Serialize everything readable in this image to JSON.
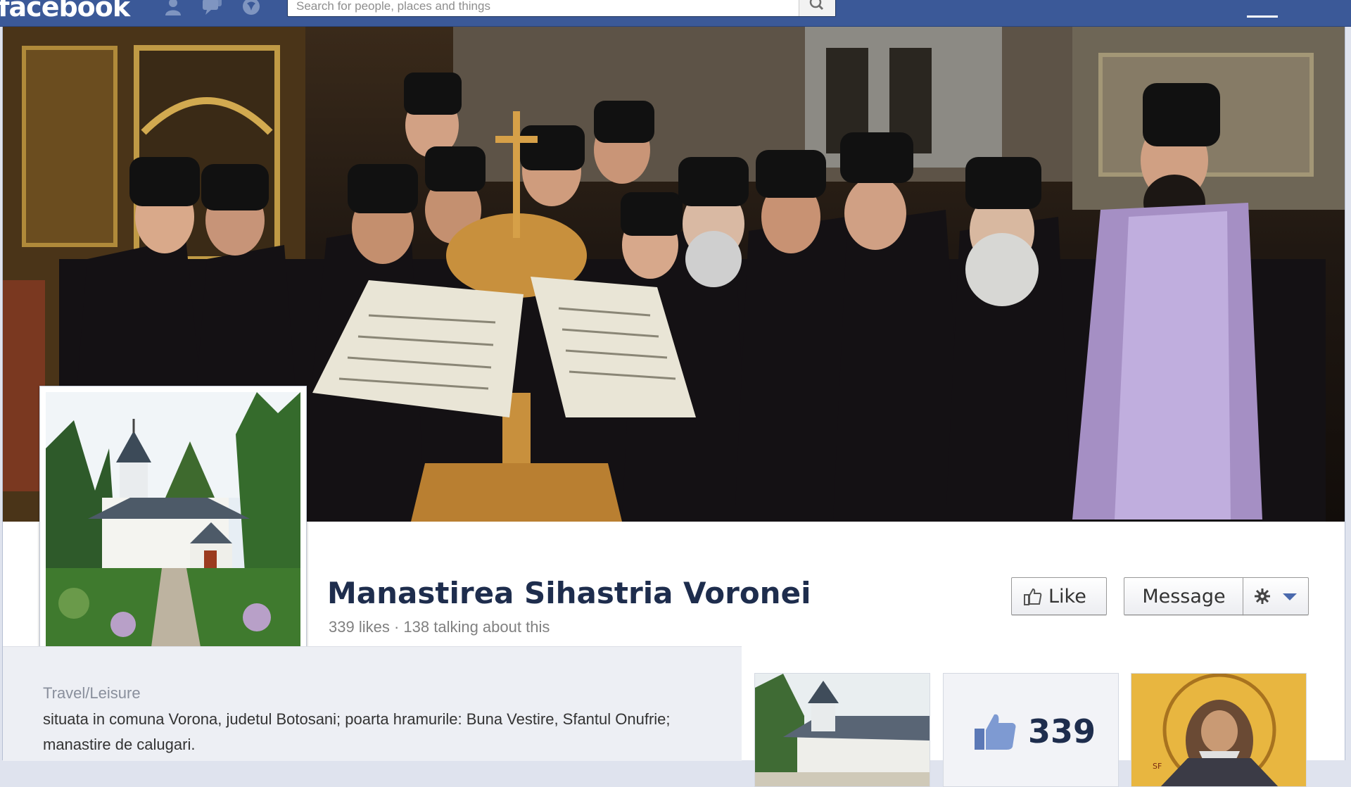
{
  "topbar": {
    "logo": "facebook",
    "search_placeholder": "Search for people, places and things",
    "colors": {
      "bar": "#3b5998",
      "border": "#29447e"
    }
  },
  "page": {
    "name": "Manastirea Sihastria Voronei",
    "likes": "339 likes",
    "separator": " · ",
    "talking": "138 talking about this"
  },
  "actions": {
    "like_label": "Like",
    "message_label": "Message"
  },
  "about": {
    "category": "Travel/Leisure",
    "description": "situata in comuna Vorona, judetul Botosani; poarta hramurile: Buna Vestire, Sfantul Onufrie; manastire de calugari."
  },
  "tiles": {
    "likes_count": "339"
  },
  "icons": [
    "friends-icon",
    "messages-icon",
    "notifications-icon",
    "search-icon",
    "thumbs-up-icon",
    "gear-icon",
    "caret-down-icon"
  ]
}
